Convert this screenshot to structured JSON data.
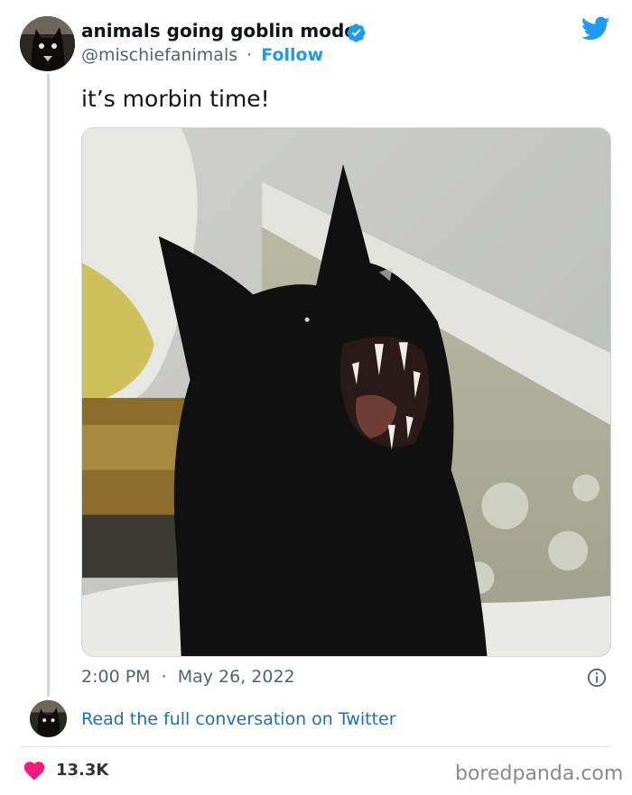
{
  "tweet": {
    "author": {
      "display_name": "animals going goblin mode",
      "handle": "@mischiefanimals",
      "verified": true,
      "separator": "·",
      "follow_label": "Follow"
    },
    "text": "it’s morbin time!",
    "media": {
      "icon": "photo-of-black-cat-with-open-mouth"
    },
    "timestamp": {
      "time": "2:00 PM",
      "separator": "·",
      "date": "May 26, 2022"
    },
    "read_more_label": "Read the full conversation on Twitter",
    "likes": "13.3K"
  },
  "footer": {
    "watermark": "boredpanda.com"
  },
  "colors": {
    "twitter_blue": "#1d9bf0",
    "link_blue": "#1d6fb8",
    "heart_red": "#f91880",
    "muted_text": "#536471",
    "primary_text": "#0f1419"
  },
  "icons": {
    "brand": "twitter-bird-icon",
    "verified": "verified-badge-icon",
    "info": "info-icon",
    "like": "heart-icon"
  }
}
